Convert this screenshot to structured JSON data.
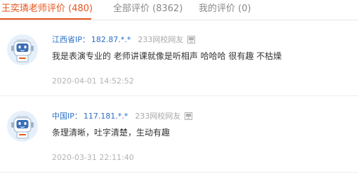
{
  "tabs": [
    {
      "label": "王奕璘老师评价 (480)",
      "active": true
    },
    {
      "label": "全部评价 (8362)",
      "active": false
    },
    {
      "label": "我的评价 (0)",
      "active": false
    }
  ],
  "accent_color": "#e8561e",
  "link_color": "#2b6fc5",
  "reviews": [
    {
      "ip_label": "江西省IP：",
      "ip_value": "182.87.*.*",
      "source": "233网校网友",
      "content": "我是表演专业的 老师讲课就像是听相声 哈哈哈 很有趣 不枯燥",
      "timestamp": "2020-04-01 14:52:52",
      "avatar_icon": "robot-avatar-icon",
      "device_icon": "pc-icon"
    },
    {
      "ip_label": "中国IP：",
      "ip_value": "117.181.*.*",
      "source": "233网校网友",
      "content": "条理清晰，吐字清楚，生动有趣",
      "timestamp": "2020-03-31 22:11:40",
      "avatar_icon": "robot-avatar-icon",
      "device_icon": "pc-icon"
    }
  ]
}
